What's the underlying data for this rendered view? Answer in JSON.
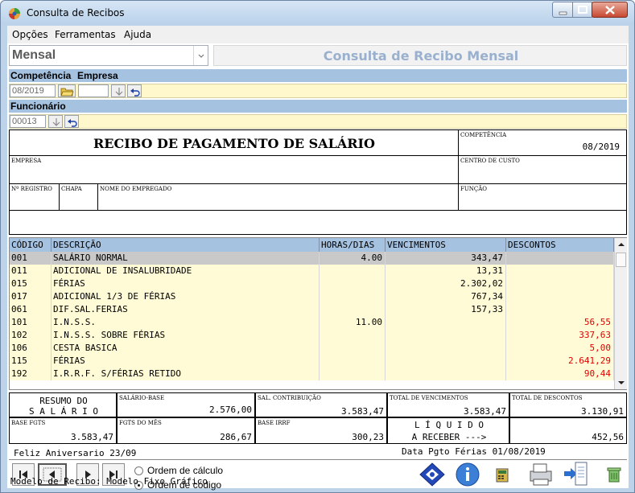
{
  "window": {
    "title": "Consulta de Recibos"
  },
  "menu": [
    "Opções",
    "Ferramentas",
    "Ajuda"
  ],
  "view_select": "Mensal",
  "header_title": "Consulta de Recibo Mensal",
  "labels": {
    "competencia": "Competência",
    "empresa": "Empresa",
    "funcionario": "Funcionário"
  },
  "competencia_value": "08/2019",
  "funcionario_value": "00013",
  "receipt": {
    "title": "RECIBO DE PAGAMENTO DE SALÁRIO",
    "competencia_label": "COMPETÊNCIA",
    "competencia": "08/2019",
    "empresa_label": "EMPRESA",
    "centro_label": "CENTRO DE CUSTO",
    "registro_label": "Nº REGISTRO",
    "chapa_label": "CHAPA",
    "nome_label": "NOME DO EMPREGADO",
    "funcao_label": "FUNÇÃO"
  },
  "grid": {
    "columns": [
      "CÓDIGO",
      "DESCRIÇÃO",
      "HORAS/DIAS",
      "VENCIMENTOS",
      "DESCONTOS"
    ],
    "rows": [
      {
        "code": "001",
        "desc": "SALÁRIO NORMAL",
        "hours": "4.00",
        "venc": "343,47",
        "desc_val": ""
      },
      {
        "code": "011",
        "desc": "ADICIONAL DE INSALUBRIDADE",
        "hours": "",
        "venc": "13,31",
        "desc_val": ""
      },
      {
        "code": "015",
        "desc": "FÉRIAS",
        "hours": "",
        "venc": "2.302,02",
        "desc_val": ""
      },
      {
        "code": "017",
        "desc": "ADICIONAL 1/3 DE FÉRIAS",
        "hours": "",
        "venc": "767,34",
        "desc_val": ""
      },
      {
        "code": "061",
        "desc": "DIF.SAL.FERIAS",
        "hours": "",
        "venc": "157,33",
        "desc_val": ""
      },
      {
        "code": "101",
        "desc": "I.N.S.S.",
        "hours": "11.00",
        "venc": "",
        "desc_val": "56,55"
      },
      {
        "code": "102",
        "desc": "I.N.S.S. SOBRE FÉRIAS",
        "hours": "",
        "venc": "",
        "desc_val": "337,63"
      },
      {
        "code": "106",
        "desc": "CESTA BASICA",
        "hours": "",
        "venc": "",
        "desc_val": "5,00"
      },
      {
        "code": "115",
        "desc": "FÉRIAS",
        "hours": "",
        "venc": "",
        "desc_val": "2.641,29"
      },
      {
        "code": "192",
        "desc": "I.R.R.F. S/FÉRIAS RETIDO",
        "hours": "",
        "venc": "",
        "desc_val": "90,44"
      }
    ]
  },
  "summary": {
    "resumo_line1": "RESUMO DO",
    "resumo_line2": "S A L Á R I O",
    "salario_base_label": "SALÁRIO-BASE",
    "salario_base": "2.576,00",
    "sal_contrib_label": "SAL. CONTRIBUIÇÃO",
    "sal_contrib": "3.583,47",
    "total_venc_label": "TOTAL DE VENCIMENTOS",
    "total_venc": "3.583,47",
    "total_desc_label": "TOTAL DE DESCONTOS",
    "total_desc": "3.130,91",
    "base_fgts_label": "BASE FGTS",
    "base_fgts": "3.583,47",
    "fgts_mes_label": "FGTS DO MÊS",
    "fgts_mes": "286,67",
    "base_irrf_label": "BASE IRRF",
    "base_irrf": "300,23",
    "liquido_line1": "L Í Q U I D O",
    "liquido_line2": "A RECEBER --->",
    "liquido": "452,56"
  },
  "messages": {
    "aniversario": "Feliz Aniversario 23/09",
    "pgto_ferias": "Data Pgto Férias 01/08/2019"
  },
  "order": {
    "calculo": "Ordem de cálculo",
    "codigo": "Ordem de código",
    "selected": "codigo"
  },
  "status": "Modelo de Recibo: Modelo Fixo Gráfico",
  "colors": {
    "header_blue": "#a5c2e0",
    "row_yellow": "#fffbd6",
    "row_selected": "#c9c9c9",
    "discount_red": "#e00000"
  }
}
